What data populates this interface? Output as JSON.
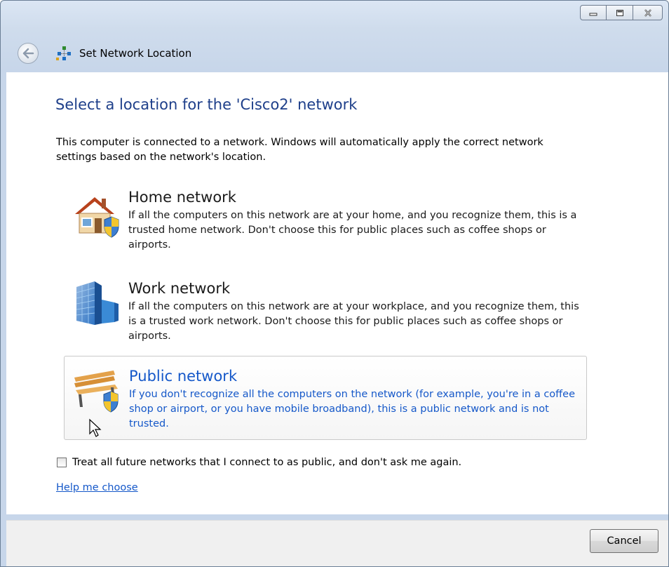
{
  "window": {
    "title": "Set Network Location",
    "caption_buttons": [
      "minimize",
      "restore",
      "close"
    ]
  },
  "page": {
    "heading": "Select a location for the 'Cisco2' network",
    "intro": "This computer is connected to a network. Windows will automatically apply the correct network settings based on the network's location."
  },
  "options": [
    {
      "id": "home",
      "icon": "house-shield-icon",
      "title": "Home network",
      "description": "If all the computers on this network are at your home, and you recognize them, this is a trusted home network.  Don't choose this for public places such as coffee shops or airports."
    },
    {
      "id": "work",
      "icon": "office-building-icon",
      "title": "Work network",
      "description": "If all the computers on this network are at your workplace, and you recognize them, this is a trusted work network.  Don't choose this for public places such as coffee shops or airports."
    },
    {
      "id": "public",
      "icon": "park-bench-shield-icon",
      "title": "Public network",
      "description": "If you don't recognize all the computers on the network (for example, you're in a coffee shop or airport, or you have mobile broadband), this is a public network and is not trusted.",
      "hovered": true
    }
  ],
  "checkbox": {
    "label": "Treat all future networks that I connect to as public, and don't ask me again.",
    "checked": false
  },
  "help_link": "Help me choose",
  "footer": {
    "cancel_label": "Cancel"
  },
  "colors": {
    "heading": "#1e3f8a",
    "link": "#1558c9",
    "titlebar": "#cfdcec"
  }
}
